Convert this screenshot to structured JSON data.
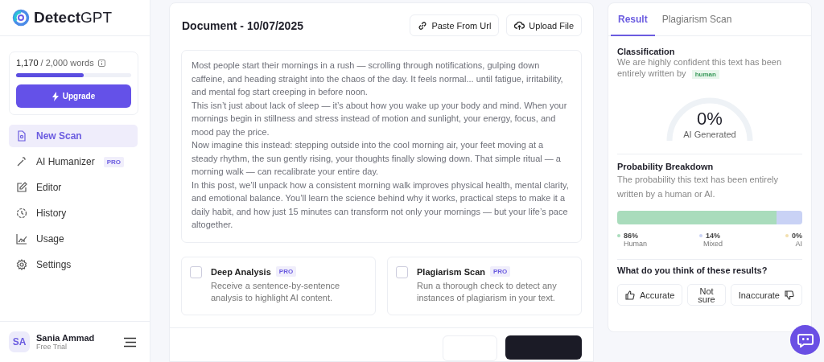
{
  "brand": {
    "name_bold": "Detect",
    "name_light": "GPT"
  },
  "usage": {
    "used": "1,170",
    "total": "/ 2,000 words",
    "level": 0.585,
    "upgrade": "Upgrade"
  },
  "nav": [
    {
      "label": "New Scan",
      "selected": true
    },
    {
      "label": "AI Humanizer",
      "selected": false,
      "badge": "PRO"
    },
    {
      "label": "Editor",
      "selected": false
    },
    {
      "label": "History",
      "selected": false
    },
    {
      "label": "Usage",
      "selected": false
    },
    {
      "label": "Settings",
      "selected": false
    }
  ],
  "user": {
    "initials": "SA",
    "name": "Sania Ammad",
    "plan": "Free Trial"
  },
  "document": {
    "title": "Document - 10/07/2025",
    "actions": [
      {
        "label": "Paste From Url"
      },
      {
        "label": "Upload File"
      }
    ],
    "paragraphs": [
      "Most people start their mornings in a rush — scrolling through notifications, gulping down caffeine, and heading straight into the chaos of the day. It feels normal... until fatigue, irritability, and mental fog start creeping in before noon.",
      "This isn’t just about lack of sleep — it’s about how you wake up your body and mind. When your mornings begin in stillness and stress instead of motion and sunlight, your energy, focus, and mood pay the price.",
      "Now imagine this instead: stepping outside into the cool morning air, your feet moving at a steady rhythm, the sun gently rising, your thoughts finally slowing down. That simple ritual — a morning walk — can recalibrate your entire day.",
      "In this post, we’ll unpack how a consistent morning walk improves physical health, mental clarity, and emotional balance. You’ll learn the science behind why it works, practical steps to make it a daily habit, and how just 15 minutes can transform not only your mornings — but your life’s pace altogether."
    ],
    "options": [
      {
        "title": "Deep Analysis",
        "badge": "PRO",
        "description": "Receive a sentence-by-sentence analysis to highlight AI content.",
        "checked": false
      },
      {
        "title": "Plagiarism Scan",
        "badge": "PRO",
        "description": "Run a thorough check to detect any instances of plagiarism in your text.",
        "checked": false
      }
    ]
  },
  "result": {
    "tabs": [
      {
        "label": "Result",
        "selected": true
      },
      {
        "label": "Plagiarism Scan",
        "selected": false
      }
    ],
    "classification": {
      "heading": "Classification",
      "text": "We are highly confident this text has been entirely written by",
      "tag": "human"
    },
    "gauge": {
      "value": "0%",
      "label": "AI Generated"
    },
    "breakdown": {
      "heading": "Probability Breakdown",
      "text": "The probability this text has been entirely written by a human or AI.",
      "parts": [
        {
          "value": "86%",
          "label": "Human",
          "level": 0.86,
          "color": "#a9dcbc"
        },
        {
          "value": "14%",
          "label": "Mixed",
          "level": 0.14,
          "color": "#c9d2f5"
        },
        {
          "value": "0%",
          "label": "AI",
          "level": 0,
          "color": "#f3dfae"
        }
      ]
    },
    "feedback": {
      "question": "What do you think of these results?",
      "buttons": [
        {
          "label": "Accurate"
        },
        {
          "label": "Not sure"
        },
        {
          "label": "Inaccurate"
        }
      ]
    }
  }
}
